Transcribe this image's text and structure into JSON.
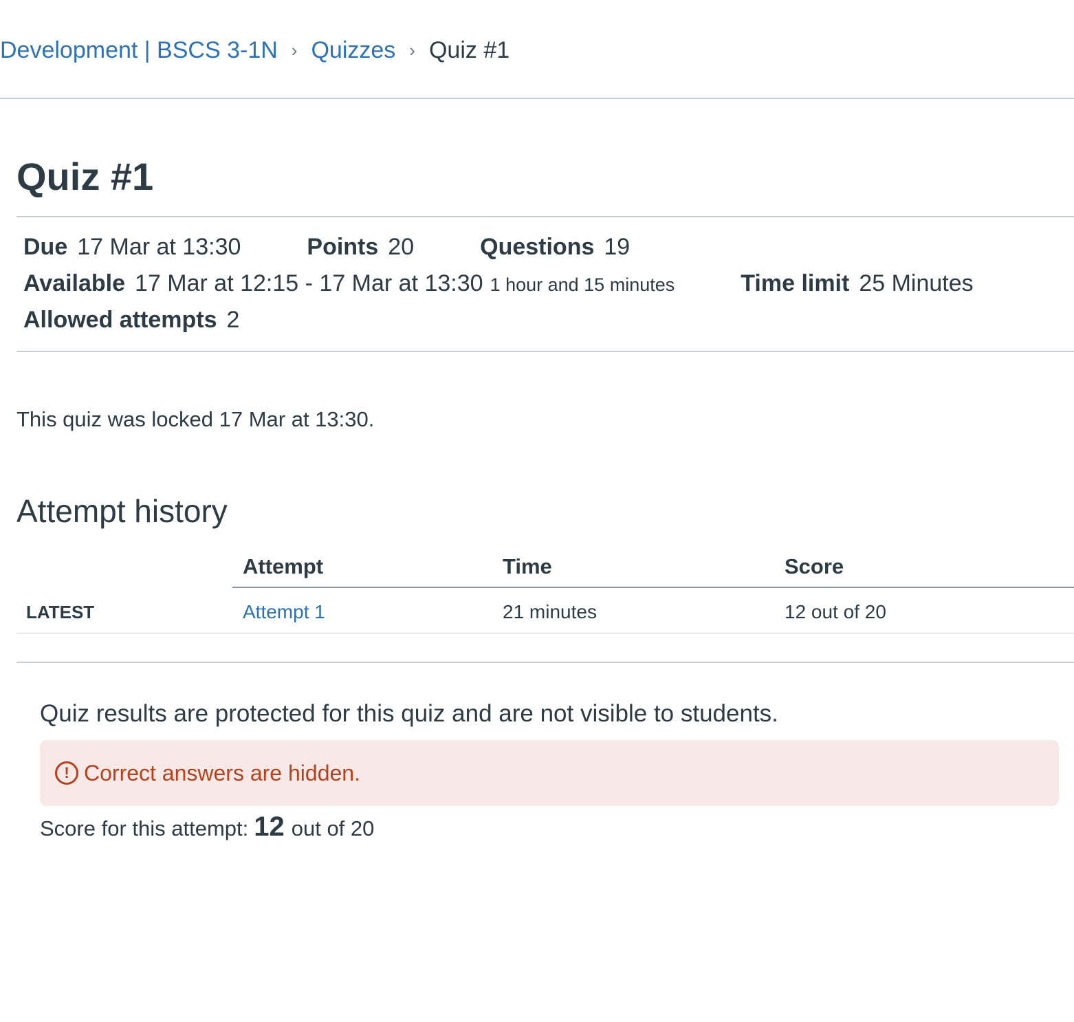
{
  "breadcrumb": {
    "course": "Development | BSCS 3-1N",
    "section": "Quizzes",
    "current": "Quiz #1"
  },
  "quiz": {
    "title": "Quiz #1",
    "due_label": "Due",
    "due_value": "17 Mar at 13:30",
    "points_label": "Points",
    "points_value": "20",
    "questions_label": "Questions",
    "questions_value": "19",
    "available_label": "Available",
    "available_value": "17 Mar at 12:15 - 17 Mar at 13:30",
    "available_duration": "1 hour and 15 minutes",
    "time_limit_label": "Time limit",
    "time_limit_value": "25 Minutes",
    "allowed_attempts_label": "Allowed attempts",
    "allowed_attempts_value": "2",
    "locked_message": "This quiz was locked 17 Mar at 13:30."
  },
  "attempt_history": {
    "heading": "Attempt history",
    "columns": [
      "",
      "Attempt",
      "Time",
      "Score"
    ],
    "rows": [
      {
        "tag": "LATEST",
        "attempt": "Attempt 1",
        "time": "21 minutes",
        "score": "12 out of 20"
      }
    ]
  },
  "results": {
    "protected_message": "Quiz results are protected for this quiz and are not visible to students.",
    "alert_icon": "exclamation-circle-icon",
    "alert_text": "Correct answers are hidden.",
    "score_prefix": "Score for this attempt:",
    "score_value": "12",
    "score_suffix": "out of 20"
  },
  "colors": {
    "link": "#2d72b5",
    "text": "#2d3b45",
    "alert_bg": "#f6e9e8",
    "alert_text": "#b8411c"
  }
}
